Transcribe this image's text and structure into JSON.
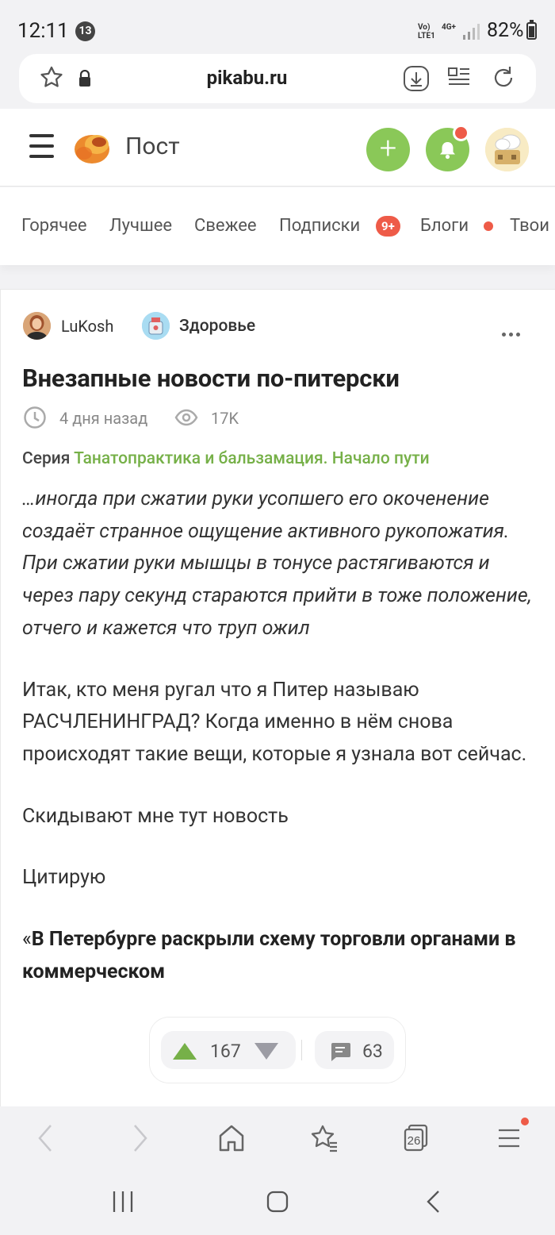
{
  "status_bar": {
    "time": "12:11",
    "notif_count": "13",
    "network_line1": "Vo)",
    "network_line2": "LTE1",
    "net_4g": "4G+",
    "battery": "82%"
  },
  "url_bar": {
    "domain": "pikabu.ru"
  },
  "header": {
    "title": "Пост",
    "add_label": "+"
  },
  "tabs": [
    {
      "label": "Горячее"
    },
    {
      "label": "Лучшее"
    },
    {
      "label": "Свежее"
    },
    {
      "label": "Подписки"
    },
    {
      "label": "Блоги"
    },
    {
      "label": "Твои"
    }
  ],
  "tabs_badge": "9+",
  "post": {
    "author": "LuKosh",
    "community": "Здоровье",
    "title": "Внезапные новости по-питерски",
    "time": "4 дня назад",
    "views": "17K",
    "series_label": "Серия",
    "series_name": "Танатопрактика и бальзамация. Начало пути",
    "quote": "…иногда при сжатии руки усопшего его окоченение создаёт странное ощущение активного рукопожатия. При сжатии руки мышцы в тонусе растягиваются и через пару секунд стараются прийти в тоже положение, отчего и кажется что труп ожил",
    "paragraphs": [
      "Итак, кто меня ругал что я Питер называю РАСЧЛЕНИНГРАД? Когда именно в нём снова происходят такие вещи, которые я узнала вот сейчас.",
      "Скидывают мне тут новость",
      "Цитирую"
    ],
    "bold_quote_open": "«",
    "bold_quote": "В Петербурге раскрыли схему торговли органами в коммерческом"
  },
  "vote_bar": {
    "rating": "167",
    "comments": "63"
  },
  "browser_bar": {
    "tabs_count": "26"
  },
  "colors": {
    "accent_green": "#8ac858",
    "link_green": "#76b048",
    "alert_red": "#ee5b48"
  }
}
